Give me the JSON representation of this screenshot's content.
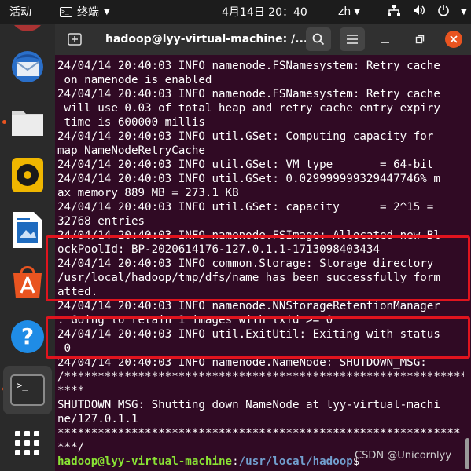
{
  "topbar": {
    "activities": "活动",
    "app_name": "终端",
    "clock": "4月14日  20：40",
    "lang": "zh",
    "icons": [
      "network-icon",
      "volume-icon",
      "power-icon"
    ]
  },
  "dock": {
    "items": [
      "thunderbird-icon",
      "files-icon",
      "rhythmbox-icon",
      "writer-icon",
      "software-icon",
      "help-icon",
      "terminal-icon",
      "apps-grid-icon"
    ],
    "accent": "#e95420"
  },
  "window": {
    "title": "hadoop@lyy-virtual-machine: /...",
    "close_color": "#e95420"
  },
  "terminal": {
    "background": "#300a24",
    "lines": [
      "24/04/14 20:40:03 INFO namenode.FSNamesystem: Retry cache",
      " on namenode is enabled",
      "24/04/14 20:40:03 INFO namenode.FSNamesystem: Retry cache",
      " will use 0.03 of total heap and retry cache entry expiry",
      " time is 600000 millis",
      "24/04/14 20:40:03 INFO util.GSet: Computing capacity for",
      "map NameNodeRetryCache",
      "24/04/14 20:40:03 INFO util.GSet: VM type       = 64-bit",
      "24/04/14 20:40:03 INFO util.GSet: 0.029999999329447746% m",
      "ax memory 889 MB = 273.1 KB",
      "24/04/14 20:40:03 INFO util.GSet: capacity      = 2^15 =",
      "32768 entries",
      "24/04/14 20:40:03 INFO namenode.FSImage: Allocated new Bl",
      "ockPoolId: BP-2020614176-127.0.1.1-1713098403434",
      "24/04/14 20:40:03 INFO common.Storage: Storage directory",
      "/usr/local/hadoop/tmp/dfs/name has been successfully form",
      "atted.",
      "24/04/14 20:40:03 INFO namenode.NNStorageRetentionManager",
      ": Going to retain 1 images with txid >= 0",
      "24/04/14 20:40:03 INFO util.ExitUtil: Exiting with status",
      " 0",
      "24/04/14 20:40:03 INFO namenode.NameNode: SHUTDOWN_MSG:",
      "/************************************************************",
      "****",
      "SHUTDOWN_MSG: Shutting down NameNode at lyy-virtual-machi",
      "ne/127.0.1.1",
      "************************************************************",
      "***/"
    ],
    "prompt": {
      "user": "hadoop@lyy-virtual-machine",
      "colon": ":",
      "path": "/usr/local/hadoop",
      "dollar": "$"
    }
  },
  "watermark": "CSDN @Unicornlyy",
  "highlight_color": "#e0141e"
}
